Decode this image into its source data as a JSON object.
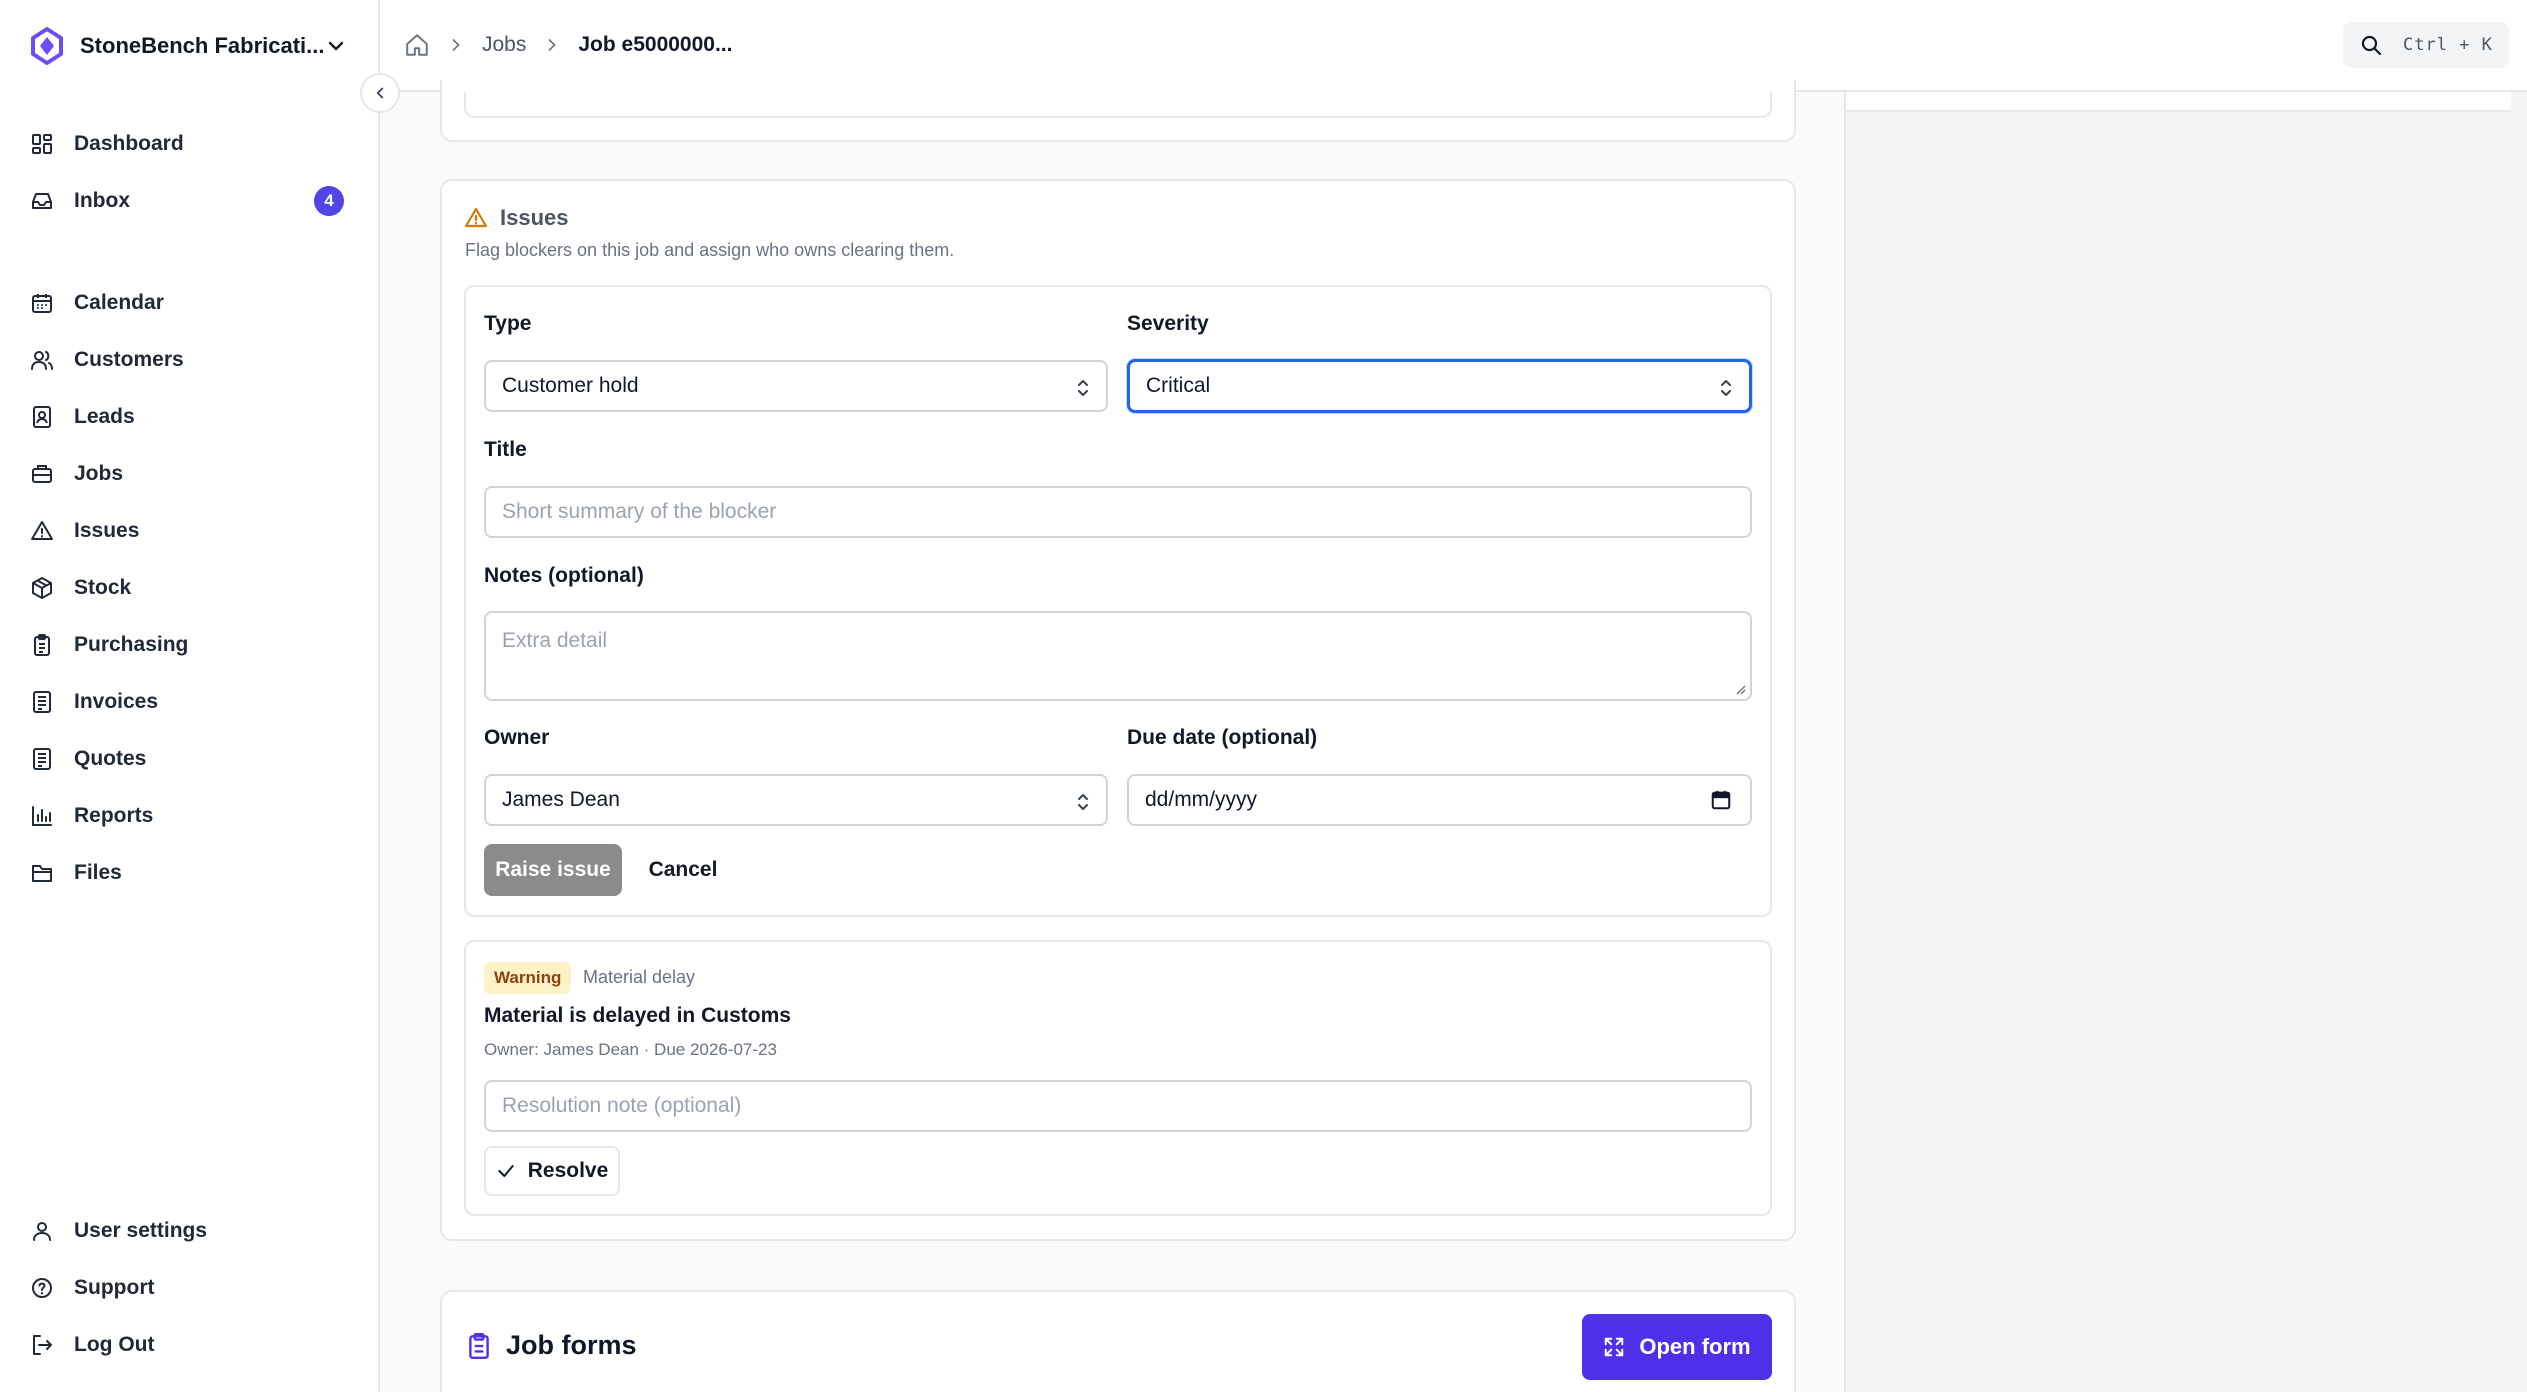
{
  "brand": {
    "name": "StoneBench Fabricati...",
    "accent": "#6c4cf5"
  },
  "nav": {
    "main": [
      {
        "label": "Dashboard",
        "icon": "dashboard-icon"
      },
      {
        "label": "Inbox",
        "icon": "inbox-icon",
        "badge": "4"
      }
    ],
    "sections": [
      {
        "label": "Calendar",
        "icon": "calendar-icon"
      },
      {
        "label": "Customers",
        "icon": "users-icon"
      },
      {
        "label": "Leads",
        "icon": "contact-icon"
      },
      {
        "label": "Jobs",
        "icon": "briefcase-icon"
      },
      {
        "label": "Issues",
        "icon": "warning-icon"
      },
      {
        "label": "Stock",
        "icon": "box-icon"
      },
      {
        "label": "Purchasing",
        "icon": "clipboard-icon"
      },
      {
        "label": "Invoices",
        "icon": "document-icon"
      },
      {
        "label": "Quotes",
        "icon": "document-icon"
      },
      {
        "label": "Reports",
        "icon": "bar-chart-icon"
      },
      {
        "label": "Files",
        "icon": "folder-icon"
      }
    ],
    "bottom": [
      {
        "label": "User settings",
        "icon": "user-icon"
      },
      {
        "label": "Support",
        "icon": "help-icon"
      },
      {
        "label": "Log Out",
        "icon": "logout-icon"
      }
    ]
  },
  "breadcrumb": {
    "jobs": "Jobs",
    "current": "Job e5000000..."
  },
  "search": {
    "shortcut": "Ctrl + K"
  },
  "issues": {
    "title": "Issues",
    "description": "Flag blockers on this job and assign who owns clearing them.",
    "form": {
      "type_label": "Type",
      "type_value": "Customer hold",
      "severity_label": "Severity",
      "severity_value": "Critical",
      "title_label": "Title",
      "title_placeholder": "Short summary of the blocker",
      "notes_label": "Notes (optional)",
      "notes_placeholder": "Extra detail",
      "owner_label": "Owner",
      "owner_value": "James Dean",
      "due_label": "Due date (optional)",
      "due_value": "dd/mm/yyyy",
      "submit_label": "Raise issue",
      "cancel_label": "Cancel"
    },
    "existing": {
      "severity": "Warning",
      "type": "Material delay",
      "title": "Material is delayed in Customs",
      "meta": "Owner: James Dean · Due 2026-07-23",
      "resolution_placeholder": "Resolution note (optional)",
      "resolve_label": "Resolve"
    }
  },
  "job_forms": {
    "title": "Job forms",
    "open_label": "Open form"
  }
}
